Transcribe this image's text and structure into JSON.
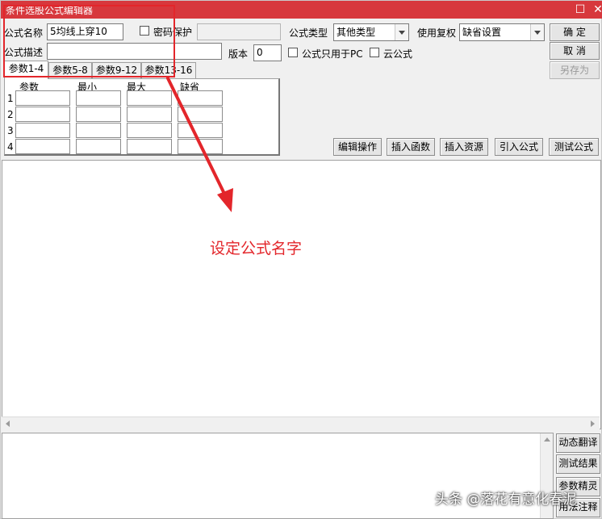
{
  "window": {
    "title": "条件选股公式编辑器"
  },
  "form": {
    "name_label": "公式名称",
    "name_value": "5均线上穿10",
    "password_label": "密码保护",
    "type_label": "公式类型",
    "type_value": "其他类型",
    "rights_label": "使用复权",
    "rights_value": "缺省设置",
    "desc_label": "公式描述",
    "desc_value": "",
    "version_label": "版本",
    "version_value": "0",
    "pc_only_label": "公式只用于PC",
    "cloud_label": "云公式"
  },
  "buttons": {
    "ok": "确  定",
    "cancel": "取  消",
    "save_as": "另存为",
    "edit_ops": "编辑操作",
    "insert_func": "插入函数",
    "insert_res": "插入资源",
    "import_formula": "引入公式",
    "test_formula": "测试公式"
  },
  "tabs": [
    {
      "label": "参数1-4"
    },
    {
      "label": "参数5-8"
    },
    {
      "label": "参数9-12"
    },
    {
      "label": "参数13-16"
    }
  ],
  "params_table": {
    "headers": [
      "参数",
      "最小",
      "最大",
      "缺省"
    ],
    "rows": [
      "1",
      "2",
      "3",
      "4"
    ]
  },
  "side_buttons": [
    "动态翻译",
    "测试结果",
    "参数精灵",
    "用法注释"
  ],
  "annotation": {
    "text": "设定公式名字"
  },
  "watermark": "头条 @落花有意化春泥",
  "colors": {
    "titlebar": "#d7383d",
    "annotation": "#e3262b"
  }
}
